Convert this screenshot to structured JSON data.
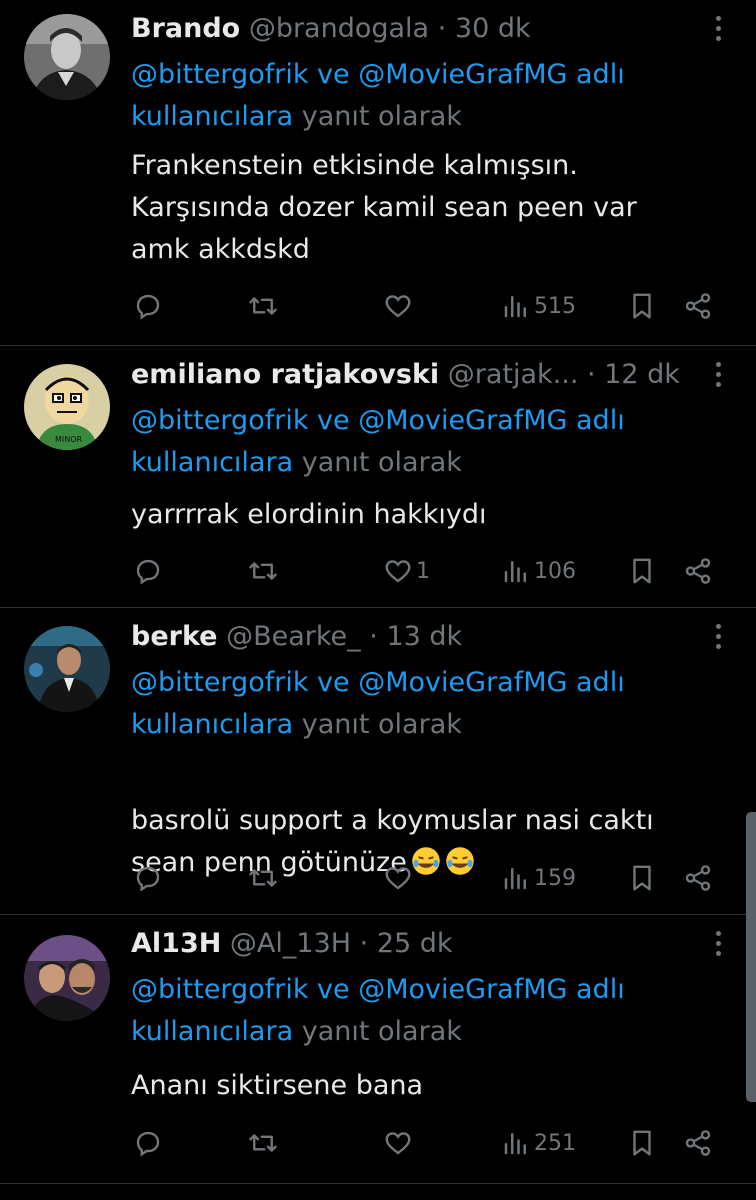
{
  "reply_prefix": {
    "mention1": "@bittergofrik",
    "connector": "ve",
    "mention2": "@MovieGrafMG adlı",
    "mention3": "kullanıcılara",
    "suffix": "yanıt olarak"
  },
  "tweets": [
    {
      "name": "Brando",
      "handle": "@brandogala",
      "separator": "·",
      "time": "30 dk",
      "text": "Frankenstein etkisinde kalmışsın.\nKarşısında dozer kamil sean peen var\namk akkdskd",
      "likes": "",
      "views": "515"
    },
    {
      "name": "emiliano ratjakovski",
      "handle": "@ratjak...",
      "separator": "·",
      "time": "12 dk",
      "text": "yarrrrak elordinin hakkıydı",
      "likes": "1",
      "views": "106"
    },
    {
      "name": "berke",
      "handle": "@Bearke_",
      "separator": "·",
      "time": "13 dk",
      "text": "basrolü support a koymuslar nasi caktı\nsean penn götünüze",
      "likes": "",
      "views": "159"
    },
    {
      "name": "Al13H",
      "handle": "@Al_13H",
      "separator": "·",
      "time": "25 dk",
      "text": "Ananı siktirsene bana",
      "likes": "",
      "views": "251"
    }
  ],
  "colors": {
    "background": "#000000",
    "text": "#e7e9ea",
    "muted": "#71767b",
    "link": "#1d9bf0",
    "divider": "#2f3336"
  },
  "icons": [
    "reply-icon",
    "retweet-icon",
    "like-icon",
    "views-icon",
    "bookmark-icon",
    "share-icon",
    "more-icon"
  ]
}
